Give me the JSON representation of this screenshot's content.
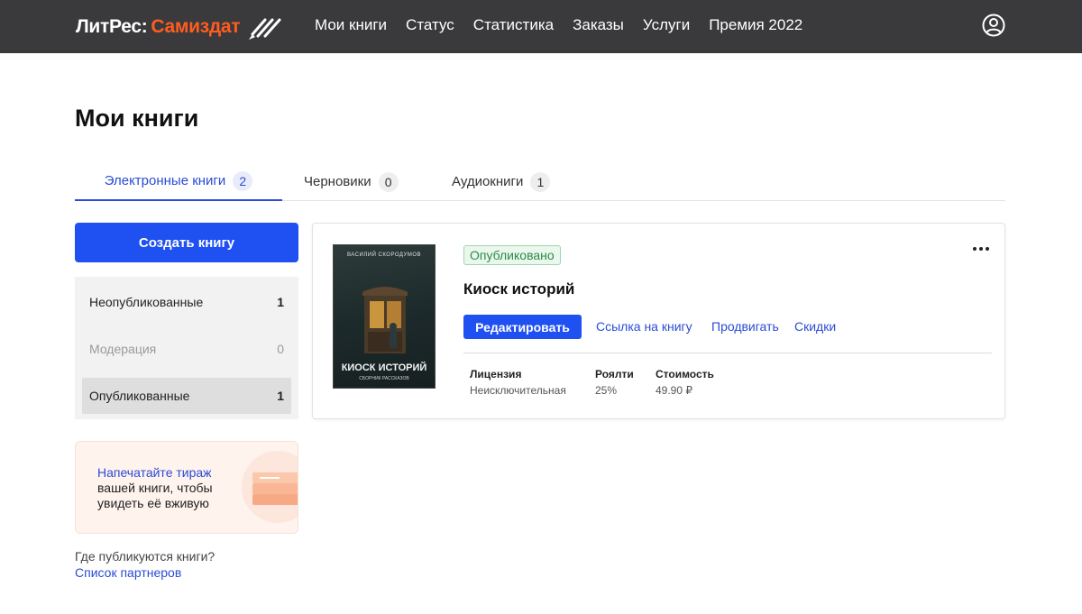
{
  "header": {
    "logo_part1": "ЛитРес:",
    "logo_part2": "Самиздат",
    "nav": [
      "Мои книги",
      "Статус",
      "Статистика",
      "Заказы",
      "Услуги",
      "Премия 2022"
    ],
    "user_icon": "user-circle-icon"
  },
  "page": {
    "title": "Мои книги"
  },
  "tabs": [
    {
      "label": "Электронные книги",
      "count": "2",
      "active": true
    },
    {
      "label": "Черновики",
      "count": "0",
      "active": false
    },
    {
      "label": "Аудиокниги",
      "count": "1",
      "active": false
    }
  ],
  "sidebar": {
    "create_label": "Создать книгу",
    "filters": [
      {
        "label": "Неопубликованные",
        "count": "1",
        "state": "normal"
      },
      {
        "label": "Модерация",
        "count": "0",
        "state": "disabled"
      },
      {
        "label": "Опубликованные",
        "count": "1",
        "state": "selected"
      }
    ],
    "promo": {
      "link": "Напечатайте тираж",
      "text": "вашей книги, чтобы увидеть её вживую"
    },
    "partners_question": "Где публикуются книги?",
    "partners_link": "Список партнеров"
  },
  "book": {
    "status": "Опубликовано",
    "title": "Киоск историй",
    "edit_label": "Редактировать",
    "links": [
      "Ссылка на книгу",
      "Продвигать",
      "Скидки"
    ],
    "cover": {
      "author": "ВАСИЛИЙ СКОРОДУМОВ",
      "title": "КИОСК ИСТОРИЙ",
      "subtitle": "СБОРНИК РАССКАЗОВ"
    },
    "meta": [
      {
        "label": "Лицензия",
        "value": "Неисключительная"
      },
      {
        "label": "Роялти",
        "value": "25%"
      },
      {
        "label": "Стоимость",
        "value": "49.90 ₽"
      }
    ]
  },
  "colors": {
    "accent": "#1f50f2",
    "header_bg": "#3a3a3c",
    "brand_orange": "#ff5c1f",
    "status_green": "#2a8c46"
  }
}
